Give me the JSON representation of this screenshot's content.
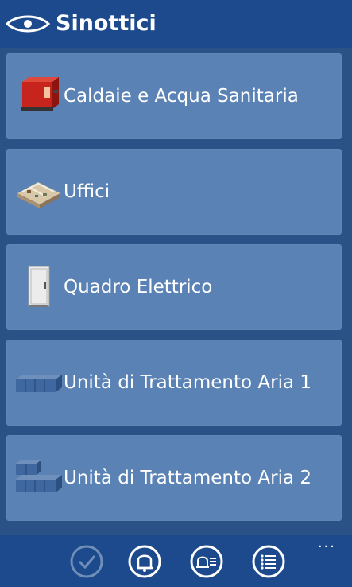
{
  "header": {
    "title": "Sinottici",
    "icon": "eye-icon"
  },
  "menu": {
    "items": [
      {
        "label": "Caldaie e Acqua Sanitaria",
        "icon": "boiler-icon"
      },
      {
        "label": "Uffici",
        "icon": "office-floorplan-icon"
      },
      {
        "label": "Quadro Elettrico",
        "icon": "electrical-panel-icon"
      },
      {
        "label": "Unità di Trattamento Aria 1",
        "icon": "air-handling-unit-icon"
      },
      {
        "label": "Unità di Trattamento Aria 2",
        "icon": "air-handling-unit-stacked-icon"
      }
    ]
  },
  "appbar": {
    "buttons": [
      {
        "icon": "check-icon",
        "enabled": false
      },
      {
        "icon": "bell-icon",
        "enabled": true
      },
      {
        "icon": "bell-list-icon",
        "enabled": true
      },
      {
        "icon": "list-icon",
        "enabled": true
      }
    ],
    "more": "..."
  },
  "colors": {
    "header_bg": "#1d4a8c",
    "list_bg": "#2a5286",
    "tile_bg": "#5a82b4",
    "text": "#ffffff",
    "disabled": "#6f8fb8"
  }
}
